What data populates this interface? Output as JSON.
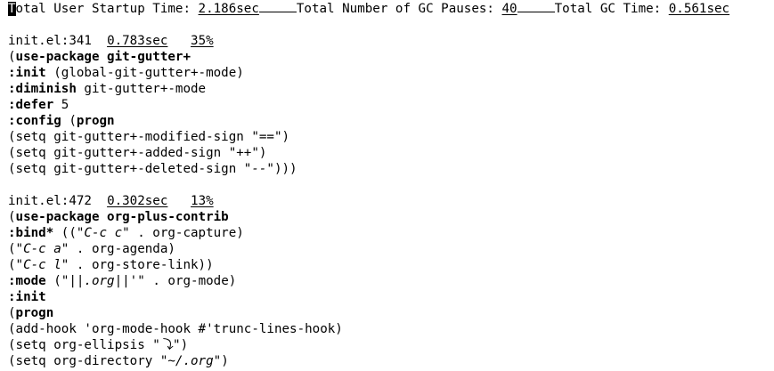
{
  "header": {
    "cursor_char": "T",
    "startup_label_rest": "otal User Startup Time: ",
    "startup_value": "2.186sec",
    "gc_label": "Total Number of GC Pauses: ",
    "gc_value": "40",
    "gctime_label": "Total GC Time: ",
    "gctime_value": "0.561sec"
  },
  "entries": [
    {
      "location": "init.el:341",
      "time": "0.783sec",
      "percent": "35%",
      "code": [
        [
          {
            "t": "(",
            "s": "n"
          },
          {
            "t": "use-package git-gutter+",
            "s": "b"
          }
        ],
        [
          {
            "t": ":init",
            "s": "b"
          },
          {
            "t": " (global-git-gutter+-mode)",
            "s": "n"
          }
        ],
        [
          {
            "t": ":diminish",
            "s": "b"
          },
          {
            "t": " git-gutter+-mode",
            "s": "n"
          }
        ],
        [
          {
            "t": ":defer",
            "s": "b"
          },
          {
            "t": " 5",
            "s": "n"
          }
        ],
        [
          {
            "t": ":config",
            "s": "b"
          },
          {
            "t": " (",
            "s": "n"
          },
          {
            "t": "progn",
            "s": "b"
          }
        ],
        [
          {
            "t": "(setq git-gutter+-modified-sign ",
            "s": "n"
          },
          {
            "t": "\"==\"",
            "s": "i"
          },
          {
            "t": ")",
            "s": "n"
          }
        ],
        [
          {
            "t": "(setq git-gutter+-added-sign ",
            "s": "n"
          },
          {
            "t": "\"++\"",
            "s": "i"
          },
          {
            "t": ")",
            "s": "n"
          }
        ],
        [
          {
            "t": "(setq git-gutter+-deleted-sign ",
            "s": "n"
          },
          {
            "t": "\"--\"",
            "s": "i"
          },
          {
            "t": ")))",
            "s": "n"
          }
        ]
      ]
    },
    {
      "location": "init.el:472",
      "time": "0.302sec",
      "percent": "13%",
      "code": [
        [
          {
            "t": "(",
            "s": "n"
          },
          {
            "t": "use-package org-plus-contrib",
            "s": "b"
          }
        ],
        [
          {
            "t": ":bind*",
            "s": "b"
          },
          {
            "t": " ((",
            "s": "n"
          },
          {
            "t": "\"C-c c\"",
            "s": "i"
          },
          {
            "t": " . org-capture)",
            "s": "n"
          }
        ],
        [
          {
            "t": "(",
            "s": "n"
          },
          {
            "t": "\"C-c a\"",
            "s": "i"
          },
          {
            "t": " . org-agenda)",
            "s": "n"
          }
        ],
        [
          {
            "t": "(",
            "s": "n"
          },
          {
            "t": "\"C-c l\"",
            "s": "i"
          },
          {
            "t": " . org-store-link))",
            "s": "n"
          }
        ],
        [
          {
            "t": ":mode",
            "s": "b"
          },
          {
            "t": " (",
            "s": "n"
          },
          {
            "t": "\"||.org||'\"",
            "s": "i"
          },
          {
            "t": " . org-mode)",
            "s": "n"
          }
        ],
        [
          {
            "t": ":init",
            "s": "b"
          }
        ],
        [
          {
            "t": "(",
            "s": "n"
          },
          {
            "t": "progn",
            "s": "b"
          }
        ],
        [
          {
            "t": "(add-hook 'org-mode-hook #'trunc-lines-hook)",
            "s": "n"
          }
        ],
        [
          {
            "t": "(setq org-ellipsis ",
            "s": "n"
          },
          {
            "t": "\"⤵\"",
            "s": "i"
          },
          {
            "t": ")",
            "s": "n"
          }
        ],
        [
          {
            "t": "(setq org-directory ",
            "s": "n"
          },
          {
            "t": "\"~/.org\"",
            "s": "i"
          },
          {
            "t": ")",
            "s": "n"
          }
        ]
      ]
    }
  ]
}
